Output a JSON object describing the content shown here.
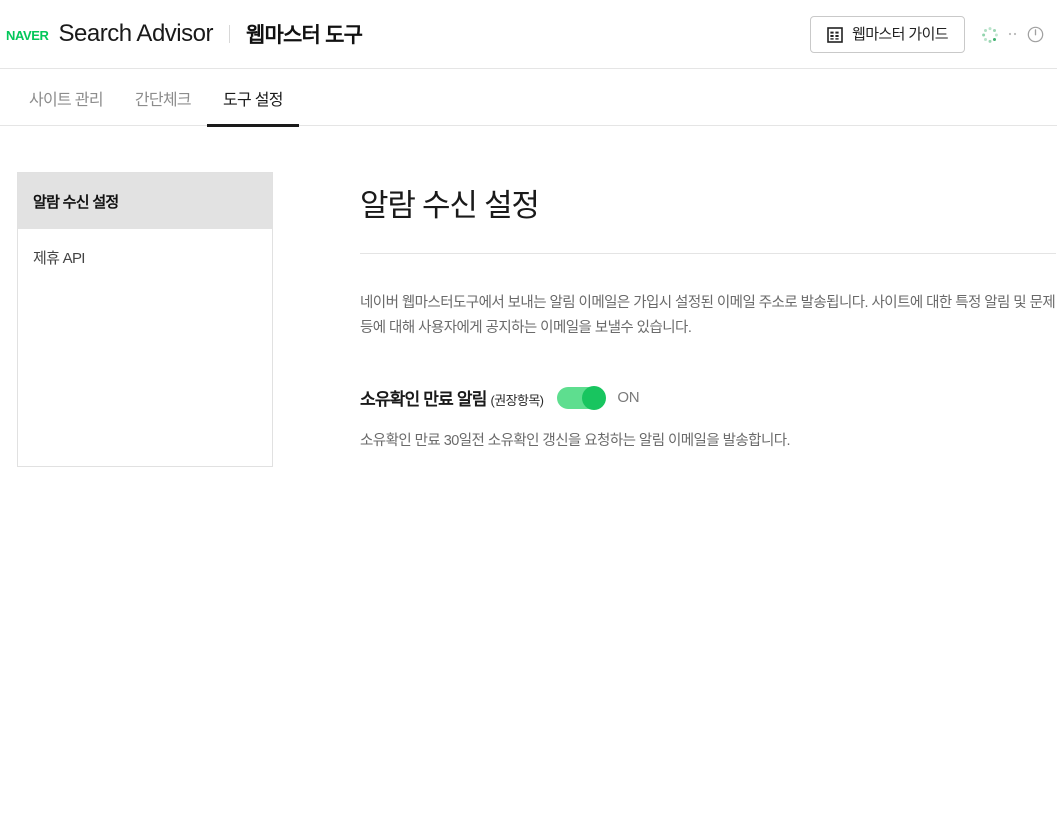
{
  "header": {
    "logo_text": "NAVER",
    "brand_title": "Search Advisor",
    "brand_sub": "웹마스터 도구",
    "guide_button_label": "웹마스터 가이드",
    "icons": {
      "guide": "grid-icon",
      "spinner": "loading-spinner-icon",
      "dots": "dots-icon",
      "power": "power-icon"
    },
    "accent_color": "#03C75A"
  },
  "tabs": [
    {
      "label": "사이트 관리",
      "active": false
    },
    {
      "label": "간단체크",
      "active": false
    },
    {
      "label": "도구 설정",
      "active": true
    }
  ],
  "sidebar": {
    "items": [
      {
        "label": "알람 수신 설정",
        "active": true
      },
      {
        "label": "제휴 API",
        "active": false
      }
    ]
  },
  "main": {
    "title": "알람 수신 설정",
    "intro": "네이버 웹마스터도구에서 보내는 알림 이메일은 가입시 설정된 이메일 주소로 발송됩니다. 사이트에 대한 특정 알림 및 문제등에 대해 사용자에게 공지하는 이메일을 보낼수 있습니다.",
    "setting": {
      "label": "소유확인 만료 알림",
      "label_sub": "(권장항목)",
      "toggle_state": "ON",
      "toggle_on": true,
      "toggle_track_color": "#5EDE8F",
      "toggle_knob_color": "#18C55F",
      "description": "소유확인 만료 30일전 소유확인 갱신을 요청하는 알림 이메일을 발송합니다."
    }
  }
}
